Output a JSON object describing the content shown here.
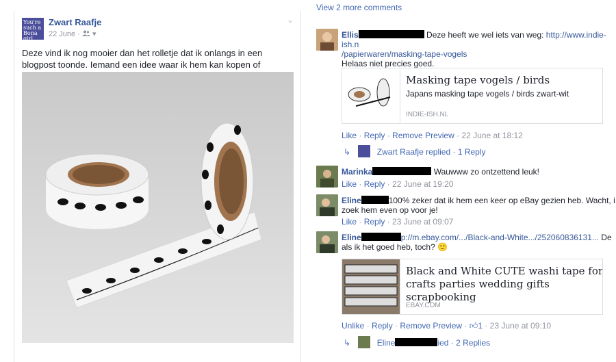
{
  "post": {
    "author": "Zwart Raafje",
    "avatar_text": "You're such a Bona girl.",
    "date": "22 June",
    "audience_icon": "friends-icon",
    "text": "Deze vind ik nog mooier dan het rolletje dat ik onlangs in een blogpost toonde. Iemand een idee waar ik hem kan kopen of bestellen?"
  },
  "comments": {
    "view_more": "View 2 more comments",
    "c1": {
      "name": "Ellis",
      "text_after": "Deze heeft we wel iets van weg: ",
      "link1": "http://www.indie-ish.n",
      "link2": "/papierwaren/masking-tape-vogels",
      "line3": "Helaas niet precies goed.",
      "preview": {
        "title": "Masking tape vogels / birds",
        "desc": "Japans masking tape vogels / birds zwart-wit",
        "source": "INDIE-ISH.NL"
      },
      "actions": {
        "like": "Like",
        "reply": "Reply",
        "remove": "Remove Preview",
        "time": "22 June at 18:12"
      },
      "reply_row": {
        "name": "Zwart Raafje",
        "text": "replied · 1 Reply"
      }
    },
    "c2": {
      "name": "Marinka",
      "text": "Wauwww zo ontzettend leuk!",
      "actions": {
        "like": "Like",
        "reply": "Reply",
        "time": "22 June at 19:20"
      }
    },
    "c3": {
      "name": "Eline",
      "text": "100% zeker dat ik hem een keer op eBay gezien heb. Wacht, i",
      "line2": "zoek hem even op voor je!",
      "actions": {
        "like": "Like",
        "reply": "Reply",
        "time": "23 June at 09:07"
      }
    },
    "c4": {
      "name": "Eline",
      "link": "p://m.ebay.com/.../Black-and-White.../252060836131...",
      "text_tail": " De",
      "line2": "als ik het goed heb, toch? 🙂",
      "preview": {
        "title": "Black and White CUTE washi tape for crafts parties wedding gifts scrapbooking",
        "source": "EBAY.COM"
      },
      "actions": {
        "unlike": "Unlike",
        "reply": "Reply",
        "remove": "Remove Preview",
        "likes": "1",
        "time": "23 June at 09:10"
      },
      "reply_row": {
        "name": "Eline",
        "text": "ied · 2 Replies"
      }
    }
  }
}
